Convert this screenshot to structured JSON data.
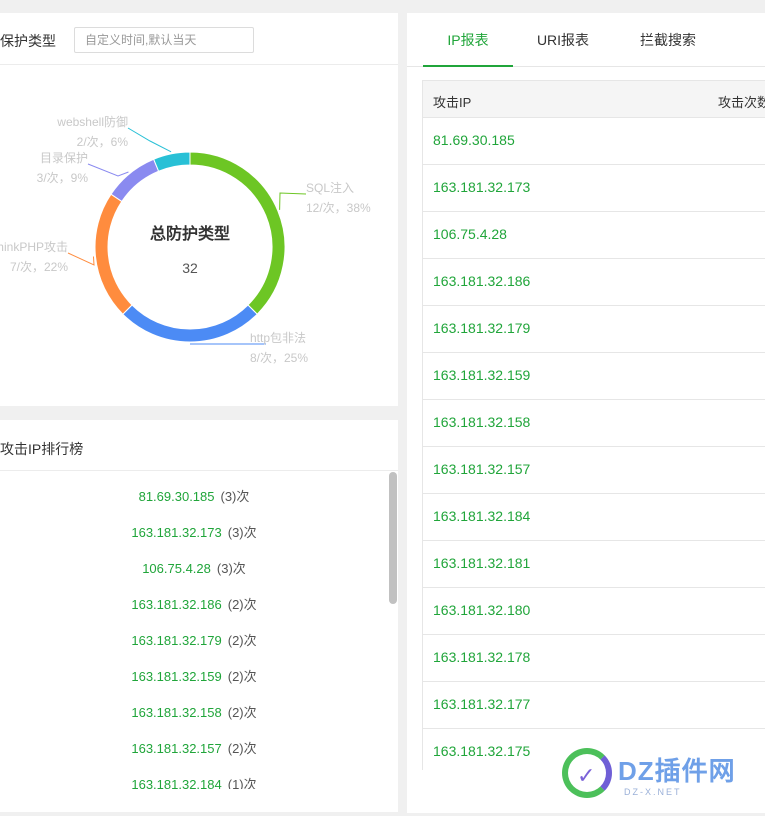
{
  "pie_panel": {
    "title": "保护类型",
    "date_placeholder": "自定义时间,默认当天"
  },
  "chart_data": {
    "type": "pie",
    "title": "总防护类型",
    "total": "32",
    "slices": [
      {
        "name": "SQL注入",
        "value": 12,
        "label": "12/次，38%",
        "color": "#6dc624"
      },
      {
        "name": "http包非法",
        "value": 8,
        "label": "8/次，25%",
        "color": "#4c8bf5"
      },
      {
        "name": "thinkPHP攻击",
        "value": 7,
        "label": "7/次，22%",
        "color": "#ff8c3e"
      },
      {
        "name": "目录保护",
        "value": 3,
        "label": "3/次，9%",
        "color": "#8a8af0"
      },
      {
        "name": "webshell防御",
        "value": 2,
        "label": "2/次，6%",
        "color": "#28c0d6"
      }
    ]
  },
  "rank_panel": {
    "title": "攻击IP排行榜",
    "items": [
      {
        "ip": "81.69.30.185",
        "count": "(3)次"
      },
      {
        "ip": "163.181.32.173",
        "count": "(3)次"
      },
      {
        "ip": "106.75.4.28",
        "count": "(3)次"
      },
      {
        "ip": "163.181.32.186",
        "count": "(2)次"
      },
      {
        "ip": "163.181.32.179",
        "count": "(2)次"
      },
      {
        "ip": "163.181.32.159",
        "count": "(2)次"
      },
      {
        "ip": "163.181.32.158",
        "count": "(2)次"
      },
      {
        "ip": "163.181.32.157",
        "count": "(2)次"
      },
      {
        "ip": "163.181.32.184",
        "count": "(1)次"
      }
    ]
  },
  "report": {
    "tabs": [
      {
        "label": "IP报表",
        "active": true
      },
      {
        "label": "URI报表",
        "active": false
      },
      {
        "label": "拦截搜索",
        "active": false
      }
    ],
    "columns": [
      "攻击IP",
      "攻击次数"
    ],
    "rows": [
      "81.69.30.185",
      "163.181.32.173",
      "106.75.4.28",
      "163.181.32.186",
      "163.181.32.179",
      "163.181.32.159",
      "163.181.32.158",
      "163.181.32.157",
      "163.181.32.184",
      "163.181.32.181",
      "163.181.32.180",
      "163.181.32.178",
      "163.181.32.177",
      "163.181.32.175"
    ]
  },
  "watermark": {
    "text": "DZ插件网",
    "sub": "DZ-X.NET",
    "icon": "dz-logo-icon"
  }
}
